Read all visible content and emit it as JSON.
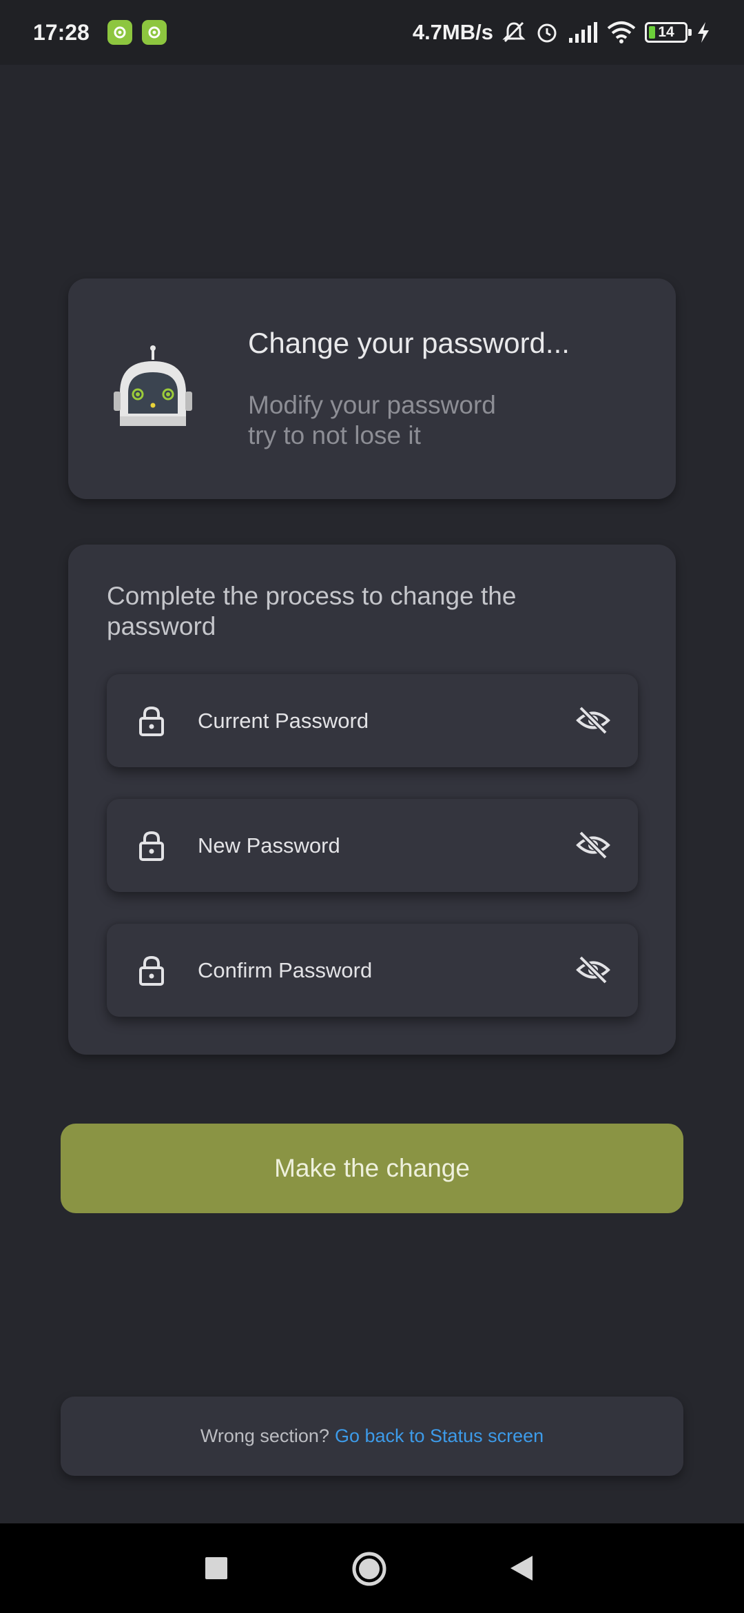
{
  "status_bar": {
    "time": "17:28",
    "network_speed": "4.7MB/s",
    "battery_level": "14",
    "icons": [
      "app-badge-icon",
      "app-badge-icon",
      "mute-icon",
      "alarm-icon",
      "signal-icon",
      "wifi-icon",
      "battery-icon",
      "charging-icon"
    ]
  },
  "header": {
    "icon": "robot-icon",
    "title": "Change your password...",
    "subtitle_line1": "Modify your password",
    "subtitle_line2": "try to not lose it"
  },
  "form": {
    "title": "Complete the process to change the password",
    "fields": [
      {
        "placeholder": "Current Password",
        "value": "",
        "icon": "lock-icon",
        "toggle_icon": "eye-off-icon"
      },
      {
        "placeholder": "New Password",
        "value": "",
        "icon": "lock-icon",
        "toggle_icon": "eye-off-icon"
      },
      {
        "placeholder": "Confirm Password",
        "value": "",
        "icon": "lock-icon",
        "toggle_icon": "eye-off-icon"
      }
    ]
  },
  "submit": {
    "label": "Make the change"
  },
  "footer": {
    "text": "Wrong section?",
    "link": "Go back to Status screen"
  },
  "nav": {
    "icons": [
      "recents-square-icon",
      "home-circle-icon",
      "back-triangle-icon"
    ]
  },
  "colors": {
    "background": "#26272d",
    "card": "#33343d",
    "accent_button": "#8a9444",
    "link": "#3d9be9",
    "robot_eyes": "#9ccc3a"
  }
}
